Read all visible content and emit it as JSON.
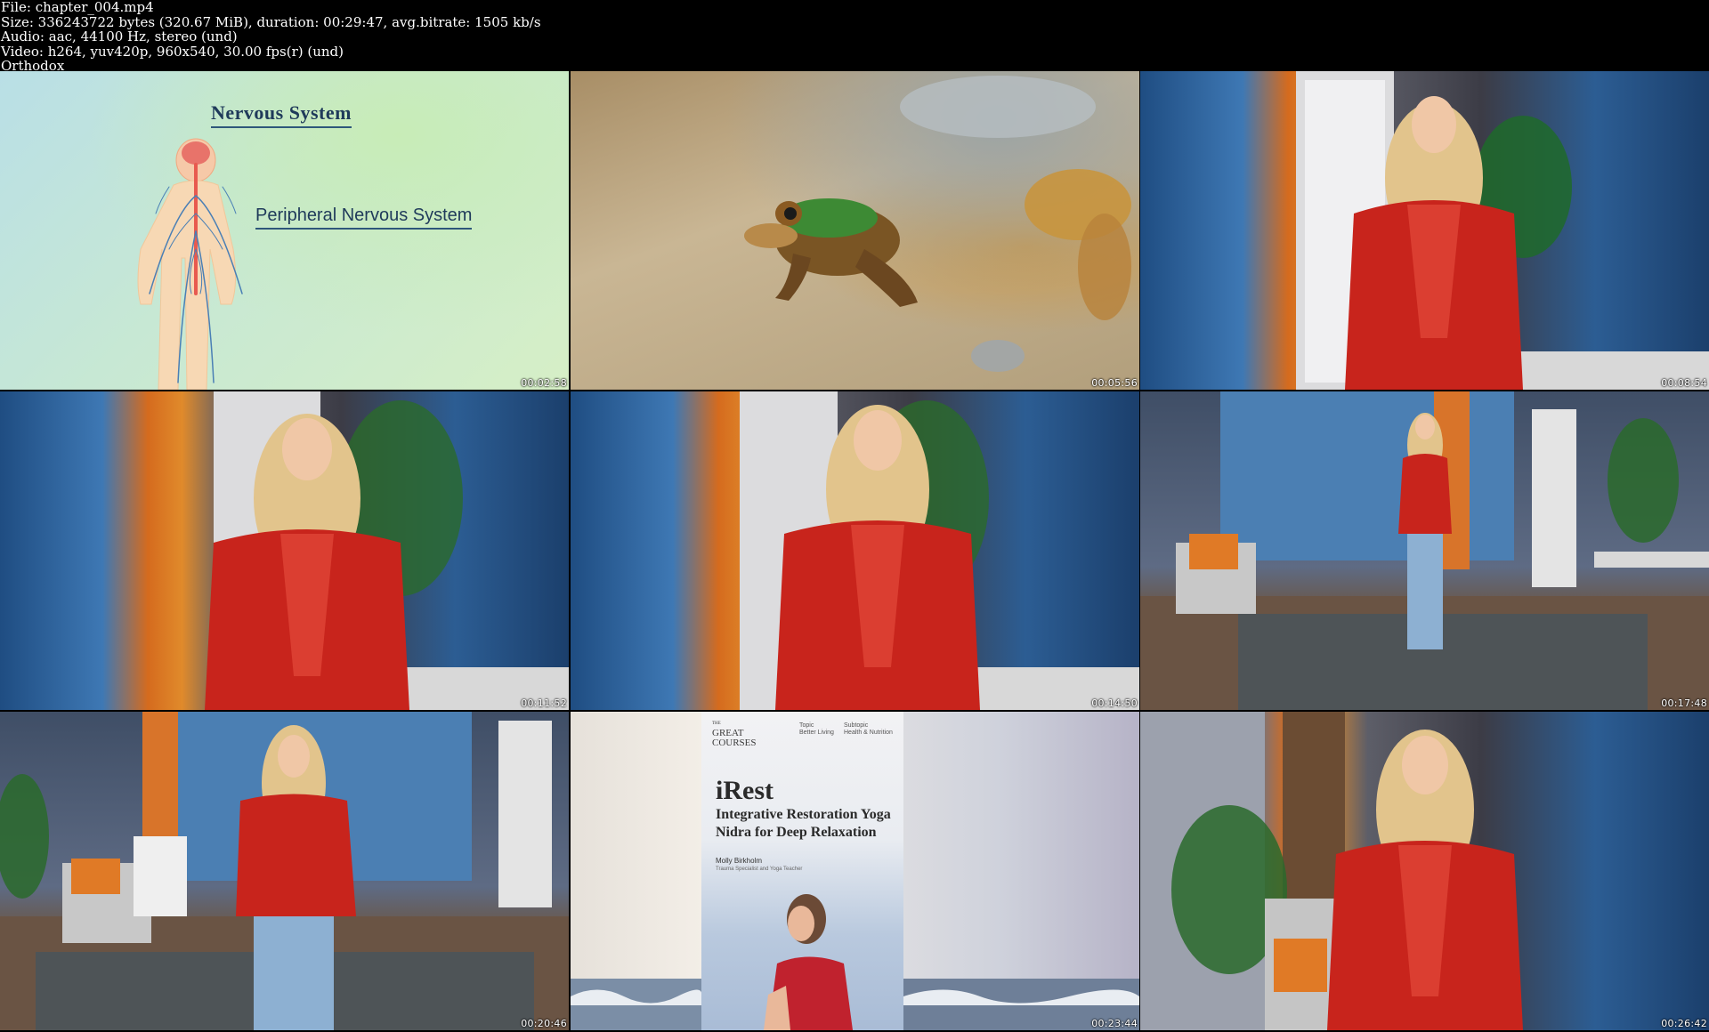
{
  "header": {
    "lines": [
      "File: chapter_004.mp4",
      "Size: 336243722 bytes (320.67 MiB), duration: 00:29:47, avg.bitrate: 1505 kb/s",
      "Audio: aac, 44100 Hz, stereo (und)",
      "Video: h264, yuv420p, 960x540, 30.00 fps(r) (und)",
      "Orthodox"
    ]
  },
  "thumbnails": [
    {
      "timestamp": "00:02:58",
      "scene": "nervous-system-diagram",
      "labels": [
        "Nervous System",
        "Peripheral Nervous System"
      ]
    },
    {
      "timestamp": "00:05:56",
      "scene": "frog-closeup"
    },
    {
      "timestamp": "00:08:54",
      "scene": "presenter-studio"
    },
    {
      "timestamp": "00:11:52",
      "scene": "presenter-studio"
    },
    {
      "timestamp": "00:14:50",
      "scene": "presenter-studio"
    },
    {
      "timestamp": "00:17:48",
      "scene": "presenter-wide-studio"
    },
    {
      "timestamp": "00:20:46",
      "scene": "presenter-wide-studio"
    },
    {
      "timestamp": "00:23:44",
      "scene": "course-cover",
      "cover": {
        "logo_small": "THE",
        "logo_line1": "GREAT",
        "logo_line2": "COURSES",
        "topic_label": "Topic",
        "topic_value": "Better Living",
        "subtopic_label": "Subtopic",
        "subtopic_value": "Health & Nutrition",
        "title": "iRest",
        "subtitle": "Integrative Restoration Yoga Nidra for Deep Relaxation",
        "author": "Molly Birkholm",
        "role": "Trauma Specialist and Yoga Teacher"
      }
    },
    {
      "timestamp": "00:26:42",
      "scene": "presenter-studio"
    }
  ],
  "colors": {
    "background": "#000000",
    "header_text": "#ffffff",
    "ns_title": "#1f3a5a",
    "shirt_red": "#c8241c"
  }
}
